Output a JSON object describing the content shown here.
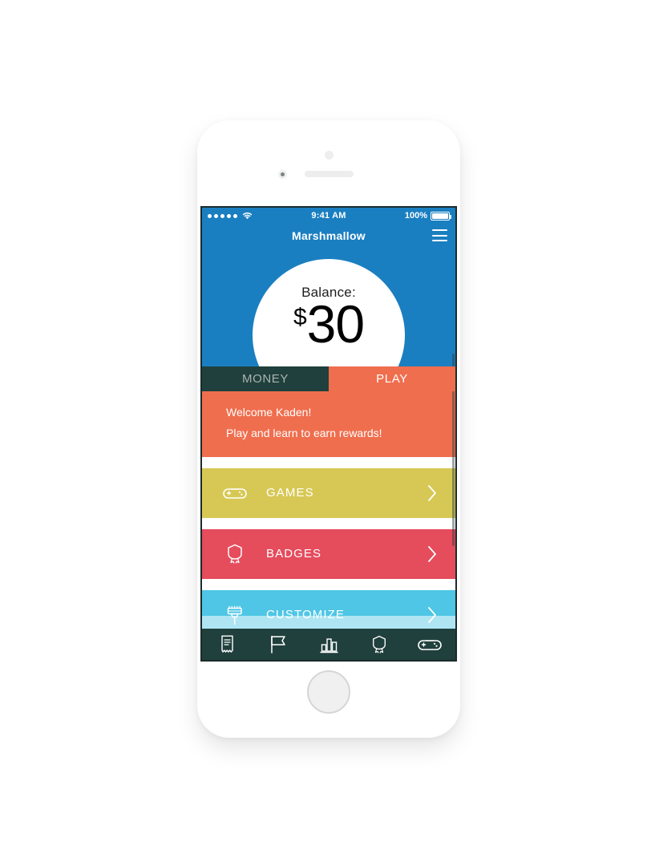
{
  "device": {
    "home_button": "home-button",
    "speaker": "speaker-grill",
    "camera": "front-camera",
    "sensor": "proximity-sensor"
  },
  "status_bar": {
    "signal_dots": 5,
    "wifi": "wifi-icon",
    "time": "9:41 AM",
    "battery_percent": "100%",
    "battery_level": 100
  },
  "nav": {
    "title": "Marshmallow",
    "menu_icon": "hamburger-menu-icon"
  },
  "hero": {
    "balance_label": "Balance:",
    "currency_symbol": "$",
    "balance_value": "30"
  },
  "tabs": [
    {
      "label": "MONEY",
      "active": true
    },
    {
      "label": "PLAY",
      "active": false
    }
  ],
  "welcome": {
    "line1": "Welcome Kaden!",
    "line2": "Play and learn to earn rewards!"
  },
  "rows": [
    {
      "label": "GAMES",
      "icon": "gamepad-icon",
      "color": "#d7c855"
    },
    {
      "label": "BADGES",
      "icon": "badge-icon",
      "color": "#e54c5c"
    },
    {
      "label": "CUSTOMIZE",
      "icon": "paintbrush-icon",
      "color": "#4fc6e5"
    }
  ],
  "bottom_nav": [
    {
      "icon": "receipt-icon"
    },
    {
      "icon": "flag-icon"
    },
    {
      "icon": "bar-chart-icon"
    },
    {
      "icon": "badge-icon"
    },
    {
      "icon": "gamepad-icon"
    }
  ],
  "colors": {
    "brand_blue": "#1a7fc1",
    "coral": "#ef6e4e",
    "dark_teal": "#20403d",
    "yellow": "#d7c855",
    "red": "#e54c5c",
    "cyan": "#4fc6e5"
  }
}
